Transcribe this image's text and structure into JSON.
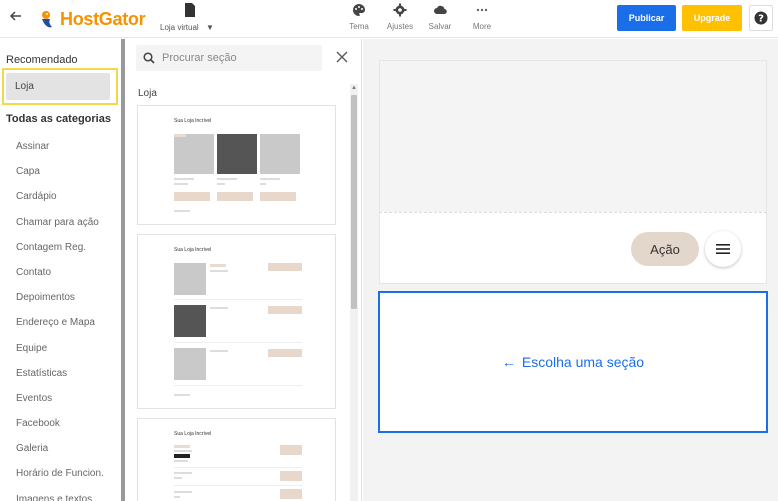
{
  "header": {
    "back_icon": "arrow-left-icon",
    "logo_text": "HostGator",
    "page_selector": "Loja virtual",
    "tools": [
      {
        "label": "Tema",
        "icon": "palette-icon"
      },
      {
        "label": "Ajustes",
        "icon": "gear-icon"
      },
      {
        "label": "Salvar",
        "icon": "cloud-icon"
      },
      {
        "label": "More",
        "icon": "more-dots-icon"
      }
    ],
    "publish_label": "Publicar",
    "upgrade_label": "Upgrade",
    "help_label": "?",
    "colors": {
      "publish": "#1a6fe8",
      "upgrade": "#ffc000",
      "logo": "#f59300"
    }
  },
  "sidebar": {
    "recommended_heading": "Recomendado",
    "recommended_item": "Loja",
    "all_heading": "Todas as categorias",
    "items": [
      "Assinar",
      "Capa",
      "Cardápio",
      "Chamar para ação",
      "Contagem Reg.",
      "Contato",
      "Depoimentos",
      "Endereço e Mapa",
      "Equipe",
      "Estatísticas",
      "Eventos",
      "Facebook",
      "Galeria",
      "Horário de Funcion.",
      "Imagens e textos"
    ]
  },
  "panel": {
    "search_placeholder": "Procurar seção",
    "category_label": "Loja",
    "thumb_title": "Sua Loja Incrível"
  },
  "preview": {
    "action_label": "Ação",
    "choose_text": "Escolha uma seção",
    "accent": "#1a6fe8"
  }
}
